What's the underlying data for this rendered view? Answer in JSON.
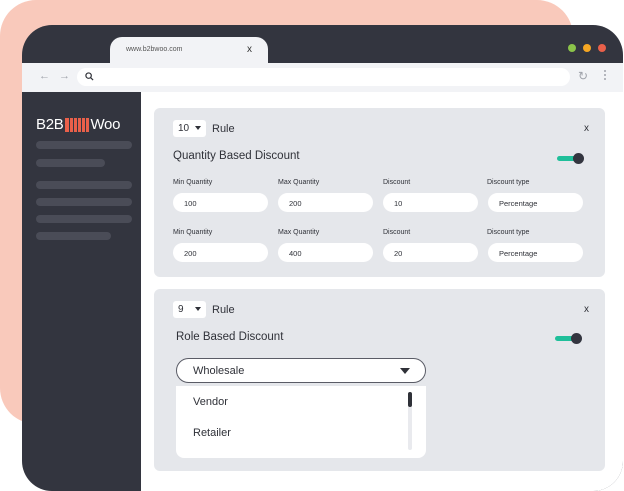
{
  "browser": {
    "tab_url": "www.b2bwoo.com",
    "tab_close": "x",
    "nav_arrows": "← →",
    "reload_glyph": "↻",
    "traffic_lights": [
      "#8bc34a",
      "#f5a623",
      "#e9604a"
    ]
  },
  "logo": {
    "left": "B2B",
    "right": "Woo"
  },
  "colors": {
    "accent": "#1fbf9a",
    "brand": "#e9604a",
    "dark": "#33353f"
  },
  "rule1": {
    "number": "10",
    "rule_label": "Rule",
    "close": "x",
    "title": "Quantity Based Discount",
    "toggle_on": true,
    "rows": [
      {
        "min_label": "Min Quantity",
        "min_value": "100",
        "max_label": "Max Quantity",
        "max_value": "200",
        "disc_label": "Discount",
        "disc_value": "10",
        "type_label": "Discount type",
        "type_value": "Percentage"
      },
      {
        "min_label": "Min Quantity",
        "min_value": "200",
        "max_label": "Max Quantity",
        "max_value": "400",
        "disc_label": "Discount",
        "disc_value": "20",
        "type_label": "Discount type",
        "type_value": "Percentage"
      }
    ]
  },
  "rule2": {
    "number": "9",
    "rule_label": "Rule",
    "close": "x",
    "title": "Role Based Discount",
    "toggle_on": true,
    "selected": "Wholesale",
    "options": [
      "Vendor",
      "Retailer"
    ]
  }
}
